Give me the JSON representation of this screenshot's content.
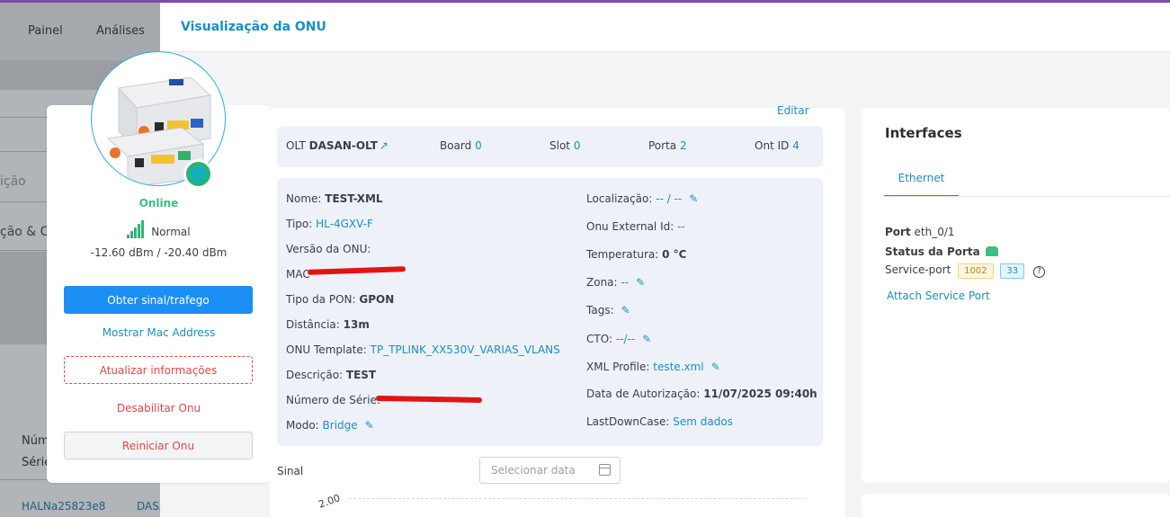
{
  "background_app": {
    "nav": [
      "Painel",
      "Análises"
    ],
    "fragment_1": "ição",
    "fragment_2": "ção & Cr",
    "col_header_1": "Núm",
    "col_header_2": "Série",
    "row_serial": "HALNa25823e8",
    "row_olt": "DASA"
  },
  "modal": {
    "title": "Visualização da ONU",
    "edit_label": "Editar"
  },
  "profile": {
    "status": "Online",
    "signal_quality": "Normal",
    "signal_dbm": "-12.60 dBm / -20.40 dBm",
    "buttons": {
      "get_signal": "Obter sinal/trafego",
      "show_mac": "Mostrar Mac Address",
      "update_info": "Atualizar informações",
      "disable": "Desabilitar Onu",
      "restart": "Reiniciar Onu"
    },
    "colors": {
      "online": "#3bbf82",
      "primary": "#1c8ff4",
      "danger": "#e0474c"
    },
    "icons": [
      "globe-icon",
      "signal-bars-icon"
    ]
  },
  "olt_bar": {
    "olt_label": "OLT",
    "olt_value": "DASAN-OLT",
    "board_label": "Board",
    "board_value": "0",
    "slot_label": "Slot",
    "slot_value": "0",
    "porta_label": "Porta",
    "porta_value": "2",
    "ontid_label": "Ont ID",
    "ontid_value": "4"
  },
  "info_left": {
    "nome_label": "Nome:",
    "nome_value": "TEST-XML",
    "tipo_label": "Tipo:",
    "tipo_value": "HL-4GXV-F",
    "versao_label": "Versão da ONU:",
    "mac_label": "MAC",
    "tipo_pon_label": "Tipo da PON:",
    "tipo_pon_value": "GPON",
    "distancia_label": "Distância:",
    "distancia_value": "13m",
    "template_label": "ONU Template:",
    "template_value": "TP_TPLINK_XX530V_VARIAS_VLANS",
    "descricao_label": "Descrição:",
    "descricao_value": "TEST",
    "serie_label": "Número de Série:",
    "modo_label": "Modo:",
    "modo_value": "Bridge"
  },
  "info_right": {
    "localizacao_label": "Localização:",
    "localizacao_value": "-- / --",
    "external_id_label": "Onu External Id:",
    "external_id_value": "--",
    "temperatura_label": "Temperatura:",
    "temperatura_value": "0 °C",
    "zona_label": "Zona:",
    "zona_value": "--",
    "tags_label": "Tags:",
    "cto_label": "CTO:",
    "cto_value": "--/--",
    "xml_label": "XML Profile:",
    "xml_value": "teste.xml",
    "autorizacao_label": "Data de Autorização:",
    "autorizacao_value": "11/07/2025 09:40h",
    "lastdown_label": "LastDownCase:",
    "lastdown_value": "Sem dados"
  },
  "chart": {
    "label": "Sinal",
    "date_placeholder": "Selecionar data",
    "first_tick": "2.00"
  },
  "interfaces": {
    "title": "Interfaces",
    "tab": "Ethernet",
    "port_label": "Port",
    "port_value": "eth_0/1",
    "status_label": "Status da Porta",
    "service_label": "Service-port",
    "service_badge_1": "1002",
    "service_badge_2": "33",
    "attach_label": "Attach Service Port"
  }
}
